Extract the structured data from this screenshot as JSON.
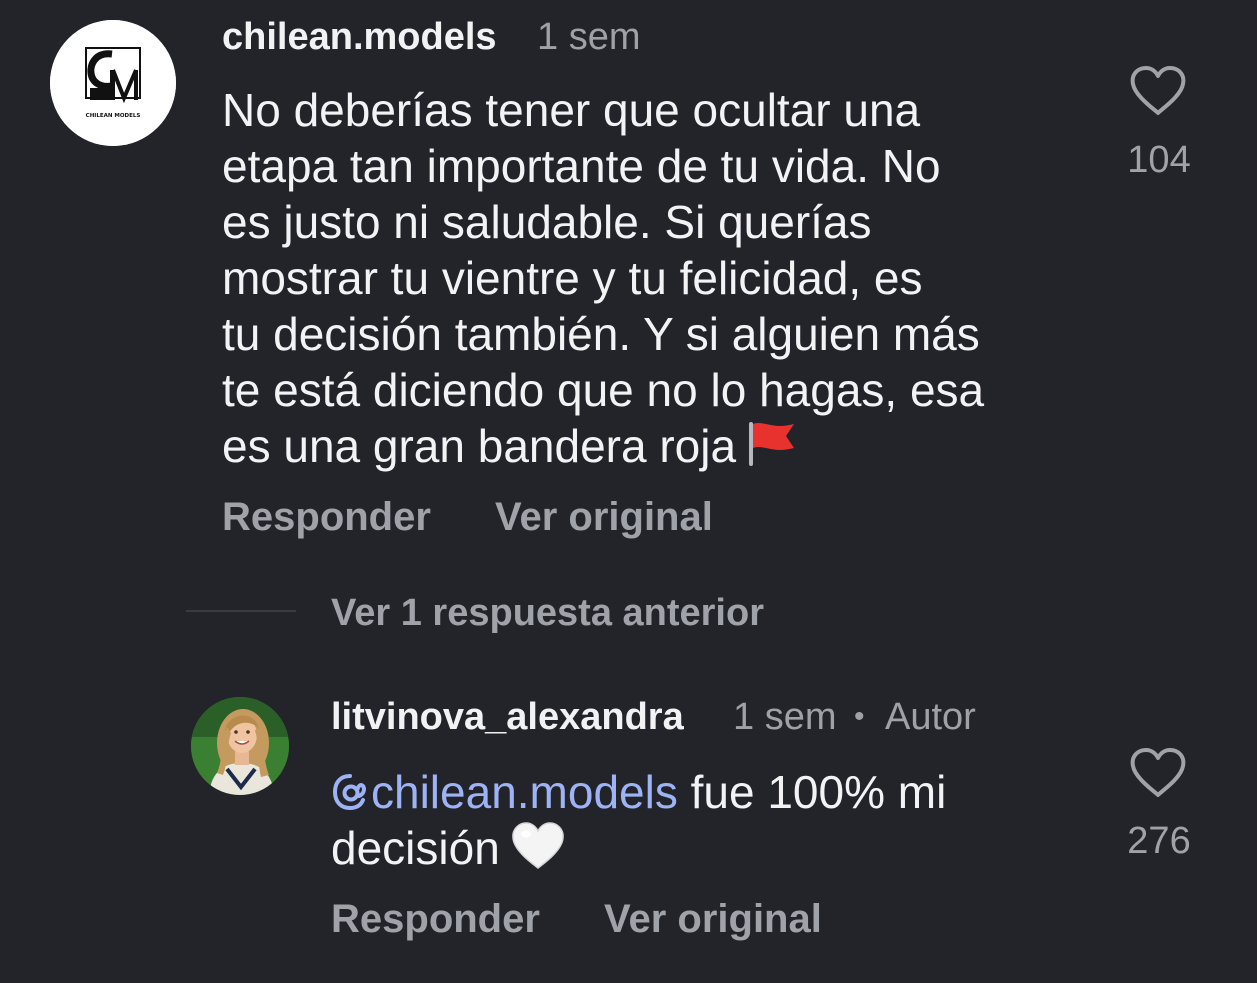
{
  "comments": [
    {
      "username": "chilean.models",
      "time": "1 sem",
      "avatar": {
        "icon": "chilean-models-logo",
        "logo_text": "CHILEAN MODELS"
      },
      "lines": [
        "No deberías tener que ocultar una",
        "etapa tan importante de tu vida. No",
        "es justo ni saludable. Si querías",
        "mostrar tu vientre y tu felicidad, es",
        "tu decisión también. Y si alguien más",
        "te está diciendo que no lo hagas, esa",
        "es una gran bandera roja"
      ],
      "emoji": "red-flag-emoji",
      "reply_label": "Responder",
      "original_label": "Ver original",
      "like_icon": "heart-outline-icon",
      "likes": "104"
    },
    {
      "username": "litvinova_alexandra",
      "time": "1 sem",
      "separator": "•",
      "badge": "Autor",
      "avatar": {
        "icon": "profile-photo"
      },
      "mention": "chilean.models",
      "text_after_mention": " fue 100% mi",
      "line2": "decisión",
      "emoji": "white-heart-emoji",
      "reply_label": "Responder",
      "original_label": "Ver original",
      "like_icon": "heart-outline-icon",
      "likes": "276"
    }
  ],
  "thread": {
    "view_replies_label": "Ver 1 respuesta anterior"
  },
  "colors": {
    "background": "#232429",
    "primary_text": "#f2f2f4",
    "secondary_text": "#a0a2a9",
    "mention": "#9eb3f6"
  }
}
